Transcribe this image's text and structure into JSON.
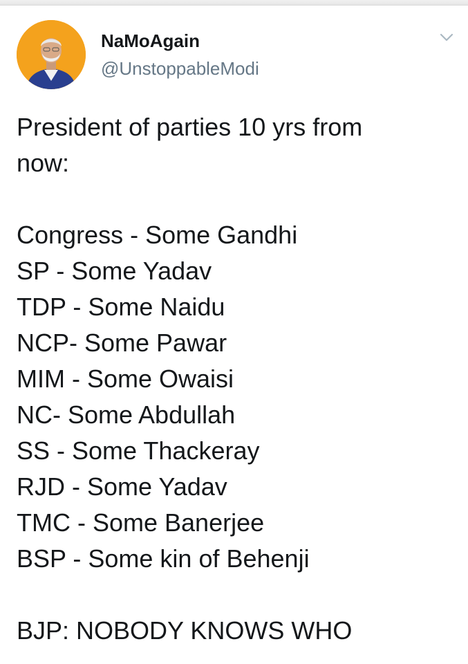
{
  "author": {
    "display_name": "NaMoAgain",
    "handle": "@UnstoppableModi",
    "avatar_icon": "profile-photo"
  },
  "menu": {
    "icon": "chevron-down-icon"
  },
  "tweet": {
    "intro_line_1": "President of parties 10 yrs from",
    "intro_line_2": "now:",
    "parties": [
      "Congress - Some Gandhi",
      "SP - Some Yadav",
      "TDP - Some Naidu",
      "NCP- Some Pawar",
      "MIM - Some Owaisi",
      "NC- Some Abdullah",
      "SS - Some Thackeray",
      "RJD - Some Yadav",
      "TMC - Some Banerjee",
      "BSP - Some kin of Behenji"
    ],
    "closing_line": "BJP: NOBODY KNOWS WHO"
  },
  "colors": {
    "text": "#14171a",
    "secondary_text": "#657786",
    "avatar_background": "#f4a21d",
    "caret": "#aab8c2"
  }
}
